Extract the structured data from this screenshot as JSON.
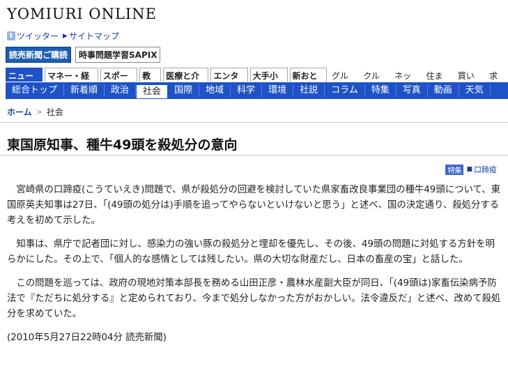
{
  "site": {
    "logo": "YOMIURI ONLINE"
  },
  "toplinks": {
    "twitter": "ツイッター",
    "twitter_icon": "t",
    "sitemap": "サイトマップ"
  },
  "banners": {
    "subscribe": "読売新聞ご購読",
    "sapix": "時事問題学習SAPIX"
  },
  "nav_top": [
    {
      "label": "ニュース",
      "active": true
    },
    {
      "label": "マネー・経済"
    },
    {
      "label": "スポーツ"
    },
    {
      "label": "教育"
    },
    {
      "label": "医療と介護"
    },
    {
      "label": "エンタメ"
    },
    {
      "label": "大手小町"
    },
    {
      "label": "新おとな"
    },
    {
      "label": "グルメ",
      "plain": true
    },
    {
      "label": "クルマ",
      "plain": true
    },
    {
      "label": "ネット",
      "plain": true
    },
    {
      "label": "住まい",
      "plain": true
    },
    {
      "label": "買い物",
      "plain": true
    },
    {
      "label": "求人",
      "plain": true
    }
  ],
  "nav_sub": [
    "総合トップ",
    "新着順",
    "政治",
    "社会",
    "国際",
    "地域",
    "科学",
    "環境",
    "社説",
    "コラム",
    "特集",
    "写真",
    "動画",
    "天気"
  ],
  "nav_sub_active": "社会",
  "breadcrumb": {
    "home": "ホーム",
    "current": "社会"
  },
  "article": {
    "title": "東国原知事、種牛49頭を殺処分の意向",
    "tag_badge": "特集",
    "tag": "口蹄疫",
    "paragraphs": [
      "宮崎県の口蹄疫(こうていえき)問題で、県が殺処分の回避を検討していた県家畜改良事業団の種牛49頭について、東国原英夫知事は27日、「(49頭の処分は)手順を追ってやらないといけないと思う」と述べ、国の決定通り、殺処分する考えを初めて示した。",
      "知事は、県庁で記者団に対し、感染力の強い豚の殺処分と埋却を優先し、その後、49頭の問題に対処する方針を明らかにした。その上で、「個人的な感情としては残したい。県の大切な財産だし、日本の畜産の宝」と話した。",
      "この問題を巡っては、政府の現地対策本部長を務める山田正彦・農林水産副大臣が同日、「(49頭は)家畜伝染病予防法で『ただちに処分する』と定められており、今まで処分しなかった方がおかしい。法令違反だ」と述べ、改めて殺処分を求めていた。"
    ],
    "dateline": "(2010年5月27日22時04分  読売新聞)"
  }
}
